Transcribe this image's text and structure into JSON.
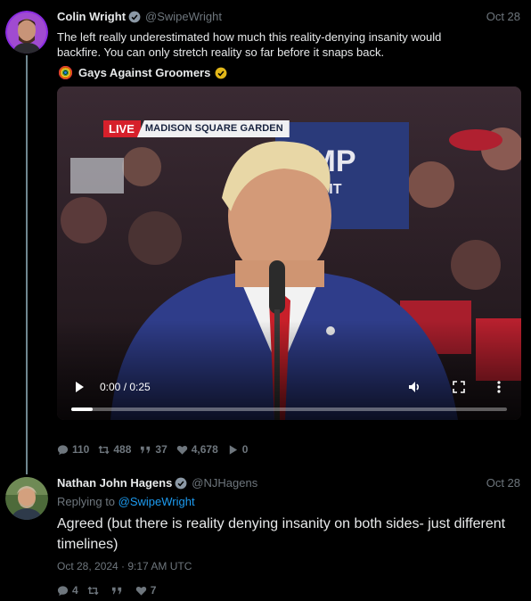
{
  "tweet1": {
    "name": "Colin Wright",
    "handle": "@SwipeWright",
    "date": "Oct 28",
    "text": "The left really underestimated how much this reality-denying insanity would backfire. You can only stretch reality so far before it snaps back.",
    "quoted_account": "Gays Against Groomers",
    "video": {
      "live_label": "LIVE",
      "location": "MADISON SQUARE GARDEN",
      "time": "0:00 / 0:25",
      "progress": 0.05
    },
    "stats": {
      "replies": "110",
      "retweets": "488",
      "quotes": "37",
      "likes": "4,678",
      "views": "0"
    }
  },
  "tweet2": {
    "name": "Nathan John Hagens",
    "handle": "@NJHagens",
    "date": "Oct 28",
    "replying_prefix": "Replying to ",
    "replying_to": "@SwipeWright",
    "text": "Agreed (but there is reality denying insanity on both sides- just different timelines)",
    "timestamp": "Oct 28, 2024 · 9:17 AM UTC",
    "stats": {
      "replies": "4",
      "retweets": "",
      "quotes": "",
      "likes": "7"
    }
  },
  "colors": {
    "background": "#000000",
    "text": "#e7e9ea",
    "muted": "#6e767d",
    "link": "#1d9bf0",
    "verified_blue": "#1d9bf0",
    "verified_gold": "#e2b719",
    "live_red": "#d6202b"
  },
  "icons": [
    "verified-icon",
    "rainbow-icon",
    "play-icon",
    "volume-icon",
    "fullscreen-icon",
    "more-icon",
    "reply-icon",
    "retweet-icon",
    "quote-icon",
    "like-icon",
    "views-icon"
  ]
}
